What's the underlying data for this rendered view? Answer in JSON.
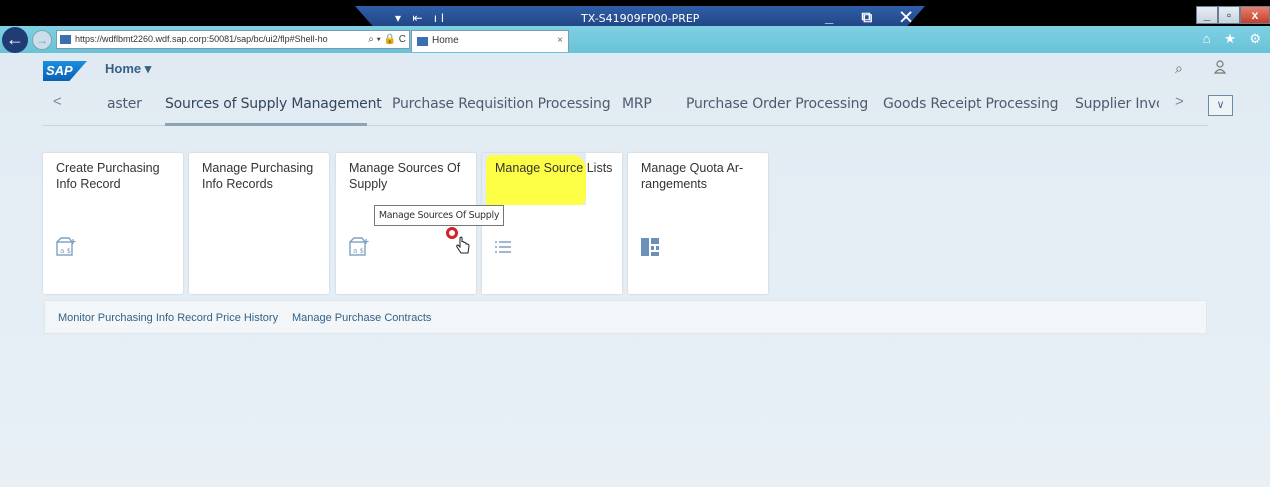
{
  "remote_session": {
    "title": "TX-S41909FP00-PREP",
    "icons": "▾ ⇤ ıl",
    "controls": "_ ⧉ ✕"
  },
  "window_controls": {
    "minimize": "_",
    "restore": "▫",
    "close": "x"
  },
  "browser": {
    "url": "https://wdflbmt2260.wdf.sap.corp:50081/sap/bc/ui2/flp#Shell-ho",
    "address_tools": "⌕ ▾ 🔒 C",
    "tab_title": "Home",
    "tab_close": "×",
    "right_icons": "⌂ ★ ⚙"
  },
  "shell": {
    "logo": "SAP",
    "home_label": "Home ▾"
  },
  "anchor_nav": {
    "prev": "<",
    "next": ">",
    "overflow": "∨",
    "tabs": [
      {
        "label": "aster"
      },
      {
        "label": "Sources of Supply Management"
      },
      {
        "label": "Purchase Requisition Processing"
      },
      {
        "label": "MRP"
      },
      {
        "label": "Purchase Order Processing"
      },
      {
        "label": "Goods Receipt Processing"
      },
      {
        "label": "Supplier Invc"
      }
    ]
  },
  "tiles": [
    {
      "title": "Create Purchasing Info Record",
      "icon": "info-record-icon"
    },
    {
      "title": "Manage Purchasing Info Records",
      "icon": ""
    },
    {
      "title": "Manage Sources Of Supply",
      "icon": "info-record-icon"
    },
    {
      "title": "Manage Source Lists",
      "icon": "list-icon"
    },
    {
      "title": "Manage Quota Ar-rangements",
      "icon": "quota-icon"
    }
  ],
  "tooltip": "Manage Sources Of Supply",
  "link_tiles": [
    "Monitor Purchasing Info Record Price History",
    "Manage Purchase Contracts"
  ],
  "colors": {
    "highlight": "#ffff33",
    "accent": "#346187",
    "click_marker": "#d4202a"
  }
}
